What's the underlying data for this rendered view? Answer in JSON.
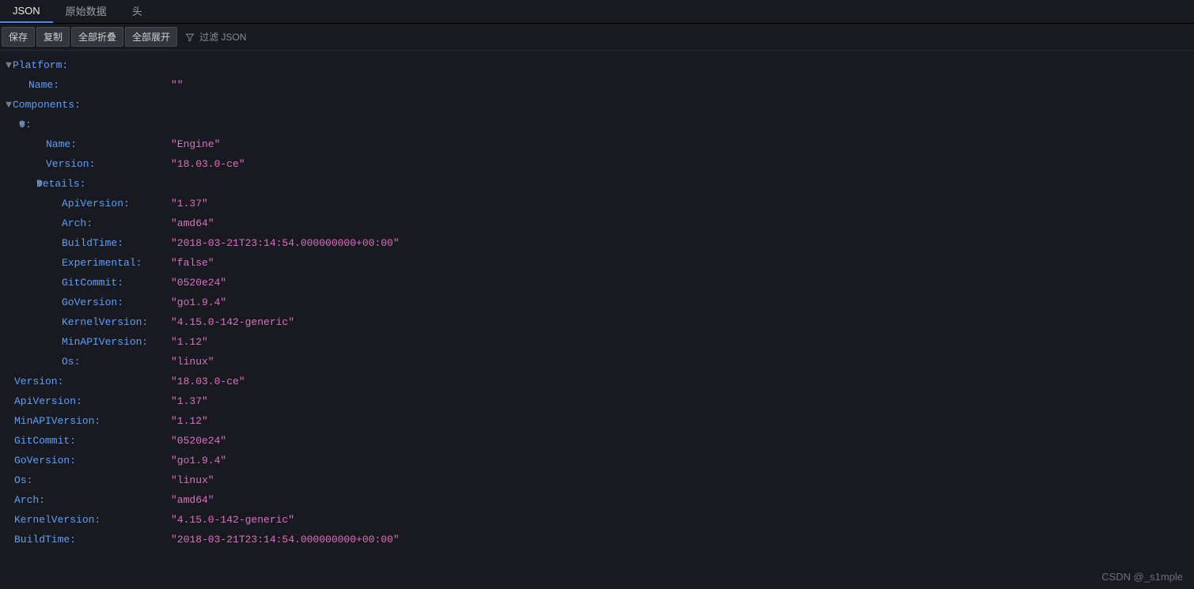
{
  "tabs": {
    "json": "JSON",
    "raw": "原始数据",
    "headers": "头"
  },
  "toolbar": {
    "save": "保存",
    "copy": "复制",
    "collapse_all": "全部折叠",
    "expand_all": "全部展开",
    "filter": "过滤 JSON"
  },
  "json": {
    "Platform": {
      "Name": "\"\""
    },
    "Components": {
      "0": {
        "Name": "\"Engine\"",
        "Version": "\"18.03.0-ce\"",
        "Details": {
          "ApiVersion": "\"1.37\"",
          "Arch": "\"amd64\"",
          "BuildTime": "\"2018-03-21T23:14:54.000000000+00:00\"",
          "Experimental": "\"false\"",
          "GitCommit": "\"0520e24\"",
          "GoVersion": "\"go1.9.4\"",
          "KernelVersion": "\"4.15.0-142-generic\"",
          "MinAPIVersion": "\"1.12\"",
          "Os": "\"linux\""
        }
      }
    },
    "Version": "\"18.03.0-ce\"",
    "ApiVersion": "\"1.37\"",
    "MinAPIVersion": "\"1.12\"",
    "GitCommit": "\"0520e24\"",
    "GoVersion": "\"go1.9.4\"",
    "Os": "\"linux\"",
    "Arch": "\"amd64\"",
    "KernelVersion": "\"4.15.0-142-generic\"",
    "BuildTime": "\"2018-03-21T23:14:54.000000000+00:00\""
  },
  "watermark": "CSDN @_s1mple"
}
